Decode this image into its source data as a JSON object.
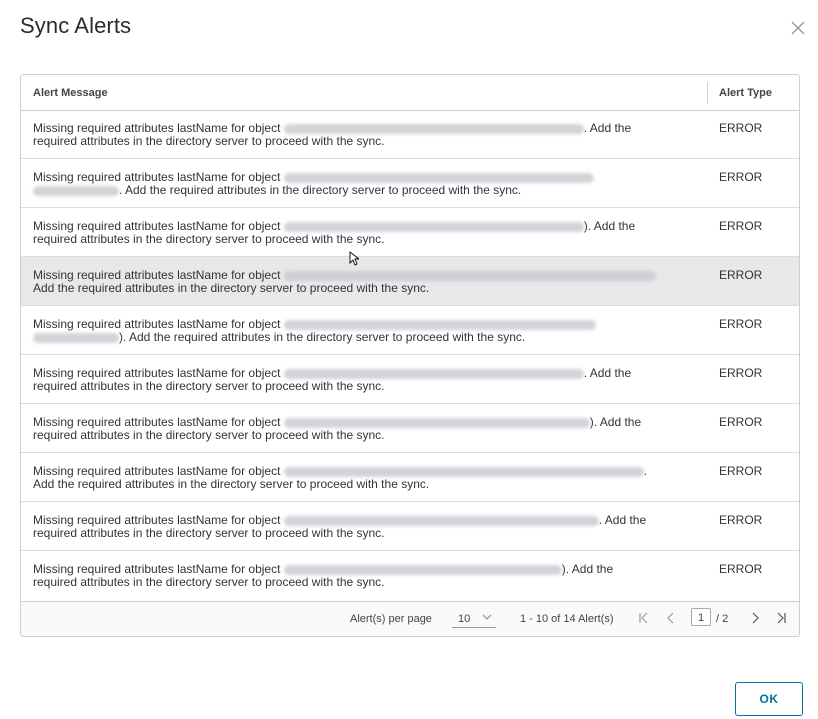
{
  "dialog": {
    "title": "Sync Alerts",
    "ok_label": "OK"
  },
  "table": {
    "columns": [
      "Alert Message",
      "Alert Type"
    ],
    "rows": [
      {
        "pre": "Missing required attributes lastName for object ",
        "post": ". Add the",
        "line2": "required attributes in the directory server to proceed with the sync.",
        "type": "ERROR"
      },
      {
        "pre": "Missing required attributes lastName for object ",
        "post": "",
        "line2": ". Add the required attributes in the directory server to proceed with the sync.",
        "type": "ERROR"
      },
      {
        "pre": "Missing required attributes lastName for object ",
        "post": "). Add the",
        "line2": "required attributes in the directory server to proceed with the sync.",
        "type": "ERROR"
      },
      {
        "pre": "Missing required attributes lastName for object ",
        "post": "",
        "line2": "Add the required attributes in the directory server to proceed with the sync.",
        "type": "ERROR"
      },
      {
        "pre": "Missing required attributes lastName for object ",
        "post": "",
        "line2": "). Add the required attributes in the directory server to proceed with the sync.",
        "type": "ERROR"
      },
      {
        "pre": "Missing required attributes lastName for object ",
        "post": ". Add the",
        "line2": "required attributes in the directory server to proceed with the sync.",
        "type": "ERROR"
      },
      {
        "pre": "Missing required attributes lastName for object ",
        "post": "). Add the",
        "line2": "required attributes in the directory server to proceed with the sync.",
        "type": "ERROR"
      },
      {
        "pre": "Missing required attributes lastName for object ",
        "post": ".",
        "line2": "Add the required attributes in the directory server to proceed with the sync.",
        "type": "ERROR"
      },
      {
        "pre": "Missing required attributes lastName for object ",
        "post": ". Add the",
        "line2": "required attributes in the directory server to proceed with the sync.",
        "type": "ERROR"
      },
      {
        "pre": "Missing required attributes lastName for object ",
        "post": "). Add the",
        "line2": "required attributes in the directory server to proceed with the sync.",
        "type": "ERROR"
      }
    ]
  },
  "pagination": {
    "per_page_label": "Alert(s) per page",
    "per_page_value": "10",
    "range_text": "1 - 10 of 14 Alert(s)",
    "current_page": "1",
    "total_pages_text": "/ 2"
  },
  "icons": {
    "close": "close-icon",
    "first": "first-page-icon",
    "prev": "prev-page-icon",
    "next": "next-page-icon",
    "last": "last-page-icon"
  },
  "colors": {
    "accent": "#0072a3",
    "row_highlight": "#e8e8e8"
  }
}
